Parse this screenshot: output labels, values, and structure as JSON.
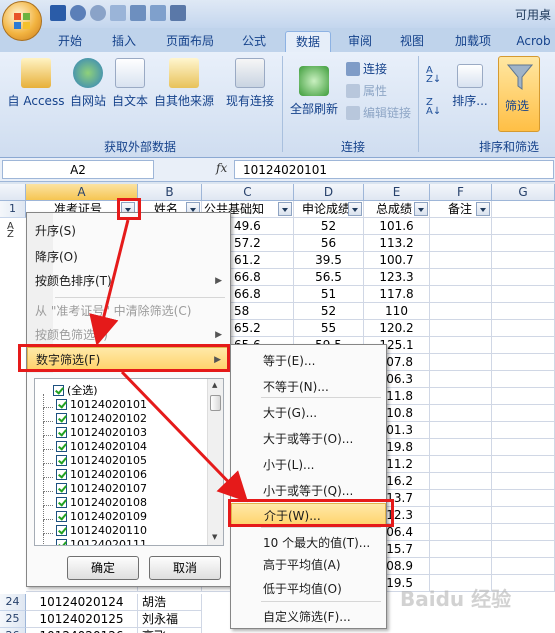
{
  "window": {
    "title": "可用桌"
  },
  "ribbon_tabs": [
    "开始",
    "插入",
    "页面布局",
    "公式",
    "数据",
    "审阅",
    "视图",
    "加载项",
    "Acrob"
  ],
  "active_tab": "数据",
  "ribbon": {
    "external_data": {
      "buttons": [
        "自 Access",
        "自网站",
        "自文本",
        "自其他来源",
        "现有连接"
      ],
      "label": "获取外部数据"
    },
    "connections": {
      "refresh": "全部刷新",
      "connect": "连接",
      "properties": "属性",
      "edit_links": "编辑链接",
      "label": "连接"
    },
    "sort_filter": {
      "sort": "排序...",
      "filter": "筛选",
      "label": "排序和筛选"
    }
  },
  "formula_bar": {
    "name_box": "A2",
    "fx": "fx",
    "value": "10124020101"
  },
  "columns": [
    "A",
    "B",
    "C",
    "D",
    "E",
    "F",
    "G"
  ],
  "rows": {
    "header": [
      "准考证号",
      "姓名",
      "公共基础知",
      "申论成绩",
      "总成绩",
      "备注"
    ],
    "scores_c": [
      "49.6",
      "57.2",
      "61.2",
      "66.8",
      "66.8",
      "58",
      "65.2",
      "65.6"
    ],
    "scores_d": [
      "52",
      "56",
      "39.5",
      "56.5",
      "51",
      "52",
      "55",
      "59.5"
    ],
    "scores_e": [
      "101.6",
      "113.2",
      "100.7",
      "123.3",
      "117.8",
      "110",
      "120.2",
      "125.1"
    ],
    "e_partial": [
      "107.1",
      "107.8",
      "106.3",
      "111.8",
      "110.8",
      "101.3",
      "119.8",
      "111.2",
      "116.2",
      "113.7",
      "112.3",
      "106.4",
      "115.7",
      "108.9",
      "119.5",
      "108.5",
      "114.0"
    ],
    "bottom_rows": [
      {
        "num": "24",
        "id": "10124020124",
        "name": "胡浩"
      },
      {
        "num": "25",
        "id": "10124020125",
        "name": "刘永福"
      },
      {
        "num": "26",
        "id": "10124020126",
        "name": "高飞"
      }
    ],
    "row_numbers": [
      "1"
    ]
  },
  "filter_menu": {
    "sort_asc": "升序(S)",
    "sort_desc": "降序(O)",
    "sort_color": "按颜色排序(T)",
    "clear_filter": "从 \"准考证号\" 中清除筛选(C)",
    "filter_color": "按颜色筛选(I)",
    "number_filter": "数字筛选(F)",
    "select_all": "(全选)",
    "items": [
      "10124020101",
      "10124020102",
      "10124020103",
      "10124020104",
      "10124020105",
      "10124020106",
      "10124020107",
      "10124020108",
      "10124020109",
      "10124020110",
      "10124020111"
    ],
    "ok": "确定",
    "cancel": "取消"
  },
  "number_submenu": {
    "items": [
      "等于(E)...",
      "不等于(N)...",
      "大于(G)...",
      "大于或等于(O)...",
      "小于(L)...",
      "小于或等于(Q)...",
      "介于(W)...",
      "10 个最大的值(T)...",
      "高于平均值(A)",
      "低于平均值(O)",
      "自定义筛选(F)..."
    ],
    "highlighted": "介于(W)..."
  },
  "watermark": "Baidu 经验",
  "colors": {
    "accent_red": "#e51a1a",
    "highlight": "#ffd36a",
    "ribbon": "#dbe5f1"
  },
  "icons": [
    "office-button-icon",
    "save-icon",
    "undo-icon",
    "redo-icon",
    "print-icon",
    "filter-funnel-icon",
    "sort-asc-icon",
    "sort-desc-icon",
    "refresh-icon"
  ]
}
